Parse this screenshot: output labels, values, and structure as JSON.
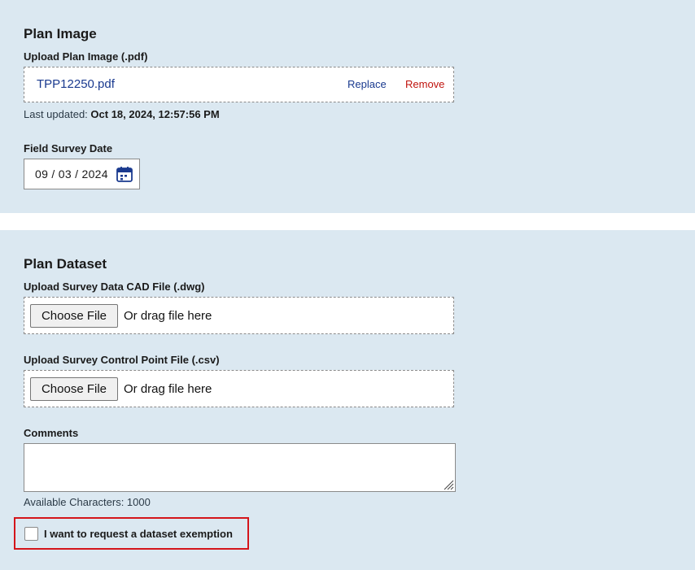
{
  "plan_image": {
    "title": "Plan Image",
    "upload_label": "Upload Plan Image (.pdf)",
    "file_name": "TPP12250.pdf",
    "replace_label": "Replace",
    "remove_label": "Remove",
    "last_updated_prefix": "Last updated:",
    "last_updated_value": "Oct 18, 2024, 12:57:56 PM",
    "survey_date_label": "Field Survey Date",
    "survey_date_value": "09 / 03 / 2024"
  },
  "plan_dataset": {
    "title": "Plan Dataset",
    "cad_upload_label": "Upload Survey Data CAD File (.dwg)",
    "csv_upload_label": "Upload Survey Control Point File (.csv)",
    "choose_file_label": "Choose File",
    "drag_text": "Or drag file here",
    "comments_label": "Comments",
    "available_chars": "Available Characters: 1000",
    "exemption_label": "I want to request a dataset exemption"
  },
  "colors": {
    "panel_bg": "#dbe8f1",
    "link_blue": "#1a3a8f",
    "remove_red": "#c0140e",
    "highlight_red": "#d4151b"
  }
}
